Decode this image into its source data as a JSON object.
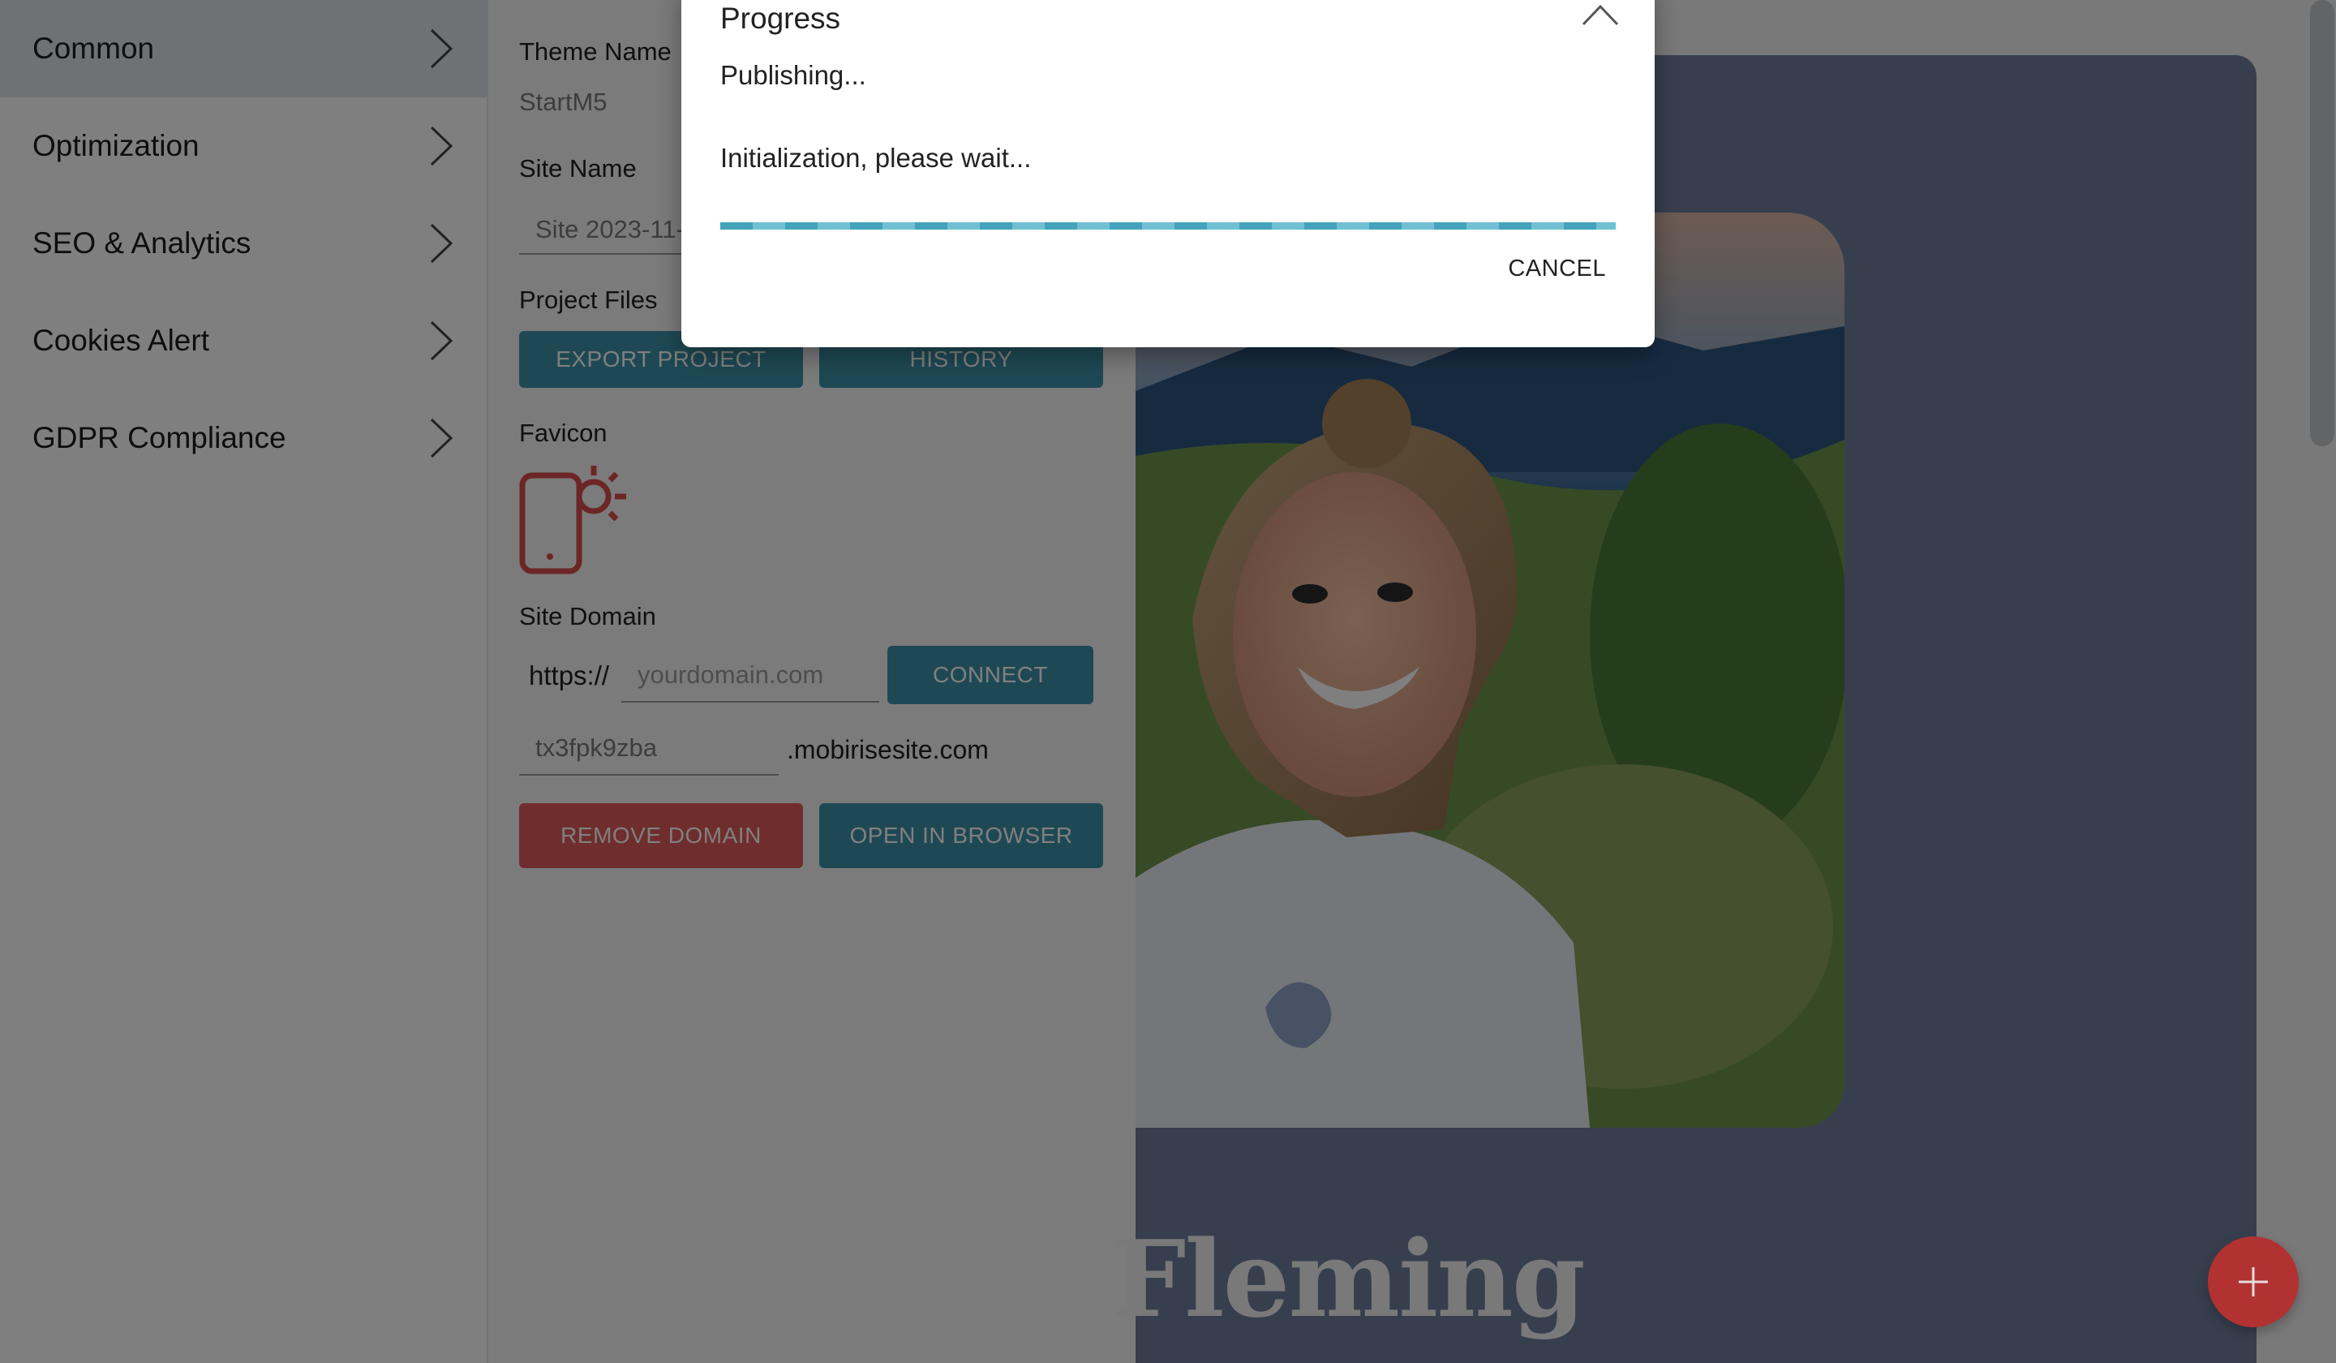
{
  "sidebar": {
    "items": [
      {
        "label": "Common",
        "active": true
      },
      {
        "label": "Optimization"
      },
      {
        "label": "SEO & Analytics"
      },
      {
        "label": "Cookies Alert"
      },
      {
        "label": "GDPR Compliance"
      }
    ]
  },
  "settings": {
    "theme_name_label": "Theme Name",
    "theme_name_value": "StartM5",
    "site_name_label": "Site Name",
    "site_name_value": "Site 2023-11-",
    "project_files_label": "Project Files",
    "export_project_label": "EXPORT PROJECT",
    "history_label": "HISTORY",
    "favicon_label": "Favicon",
    "site_domain_label": "Site Domain",
    "https_prefix": "https://",
    "domain_placeholder": "yourdomain.com",
    "connect_label": "CONNECT",
    "subdomain_value": "tx3fpk9zba",
    "subdomain_suffix": ".mobirisesite.com",
    "remove_domain_label": "REMOVE DOMAIN",
    "open_in_browser_label": "OPEN IN BROWSER"
  },
  "preview": {
    "heading_fragment": "Fleming"
  },
  "modal": {
    "title": "Progress",
    "status": "Publishing...",
    "message": "Initialization, please wait...",
    "progress": 1.0,
    "cancel_label": "CANCEL"
  },
  "colors": {
    "accent_teal": "#3d93a8",
    "danger_red": "#e05a5a",
    "fab_red": "#e04040",
    "favicon_red": "#d94c4c"
  }
}
